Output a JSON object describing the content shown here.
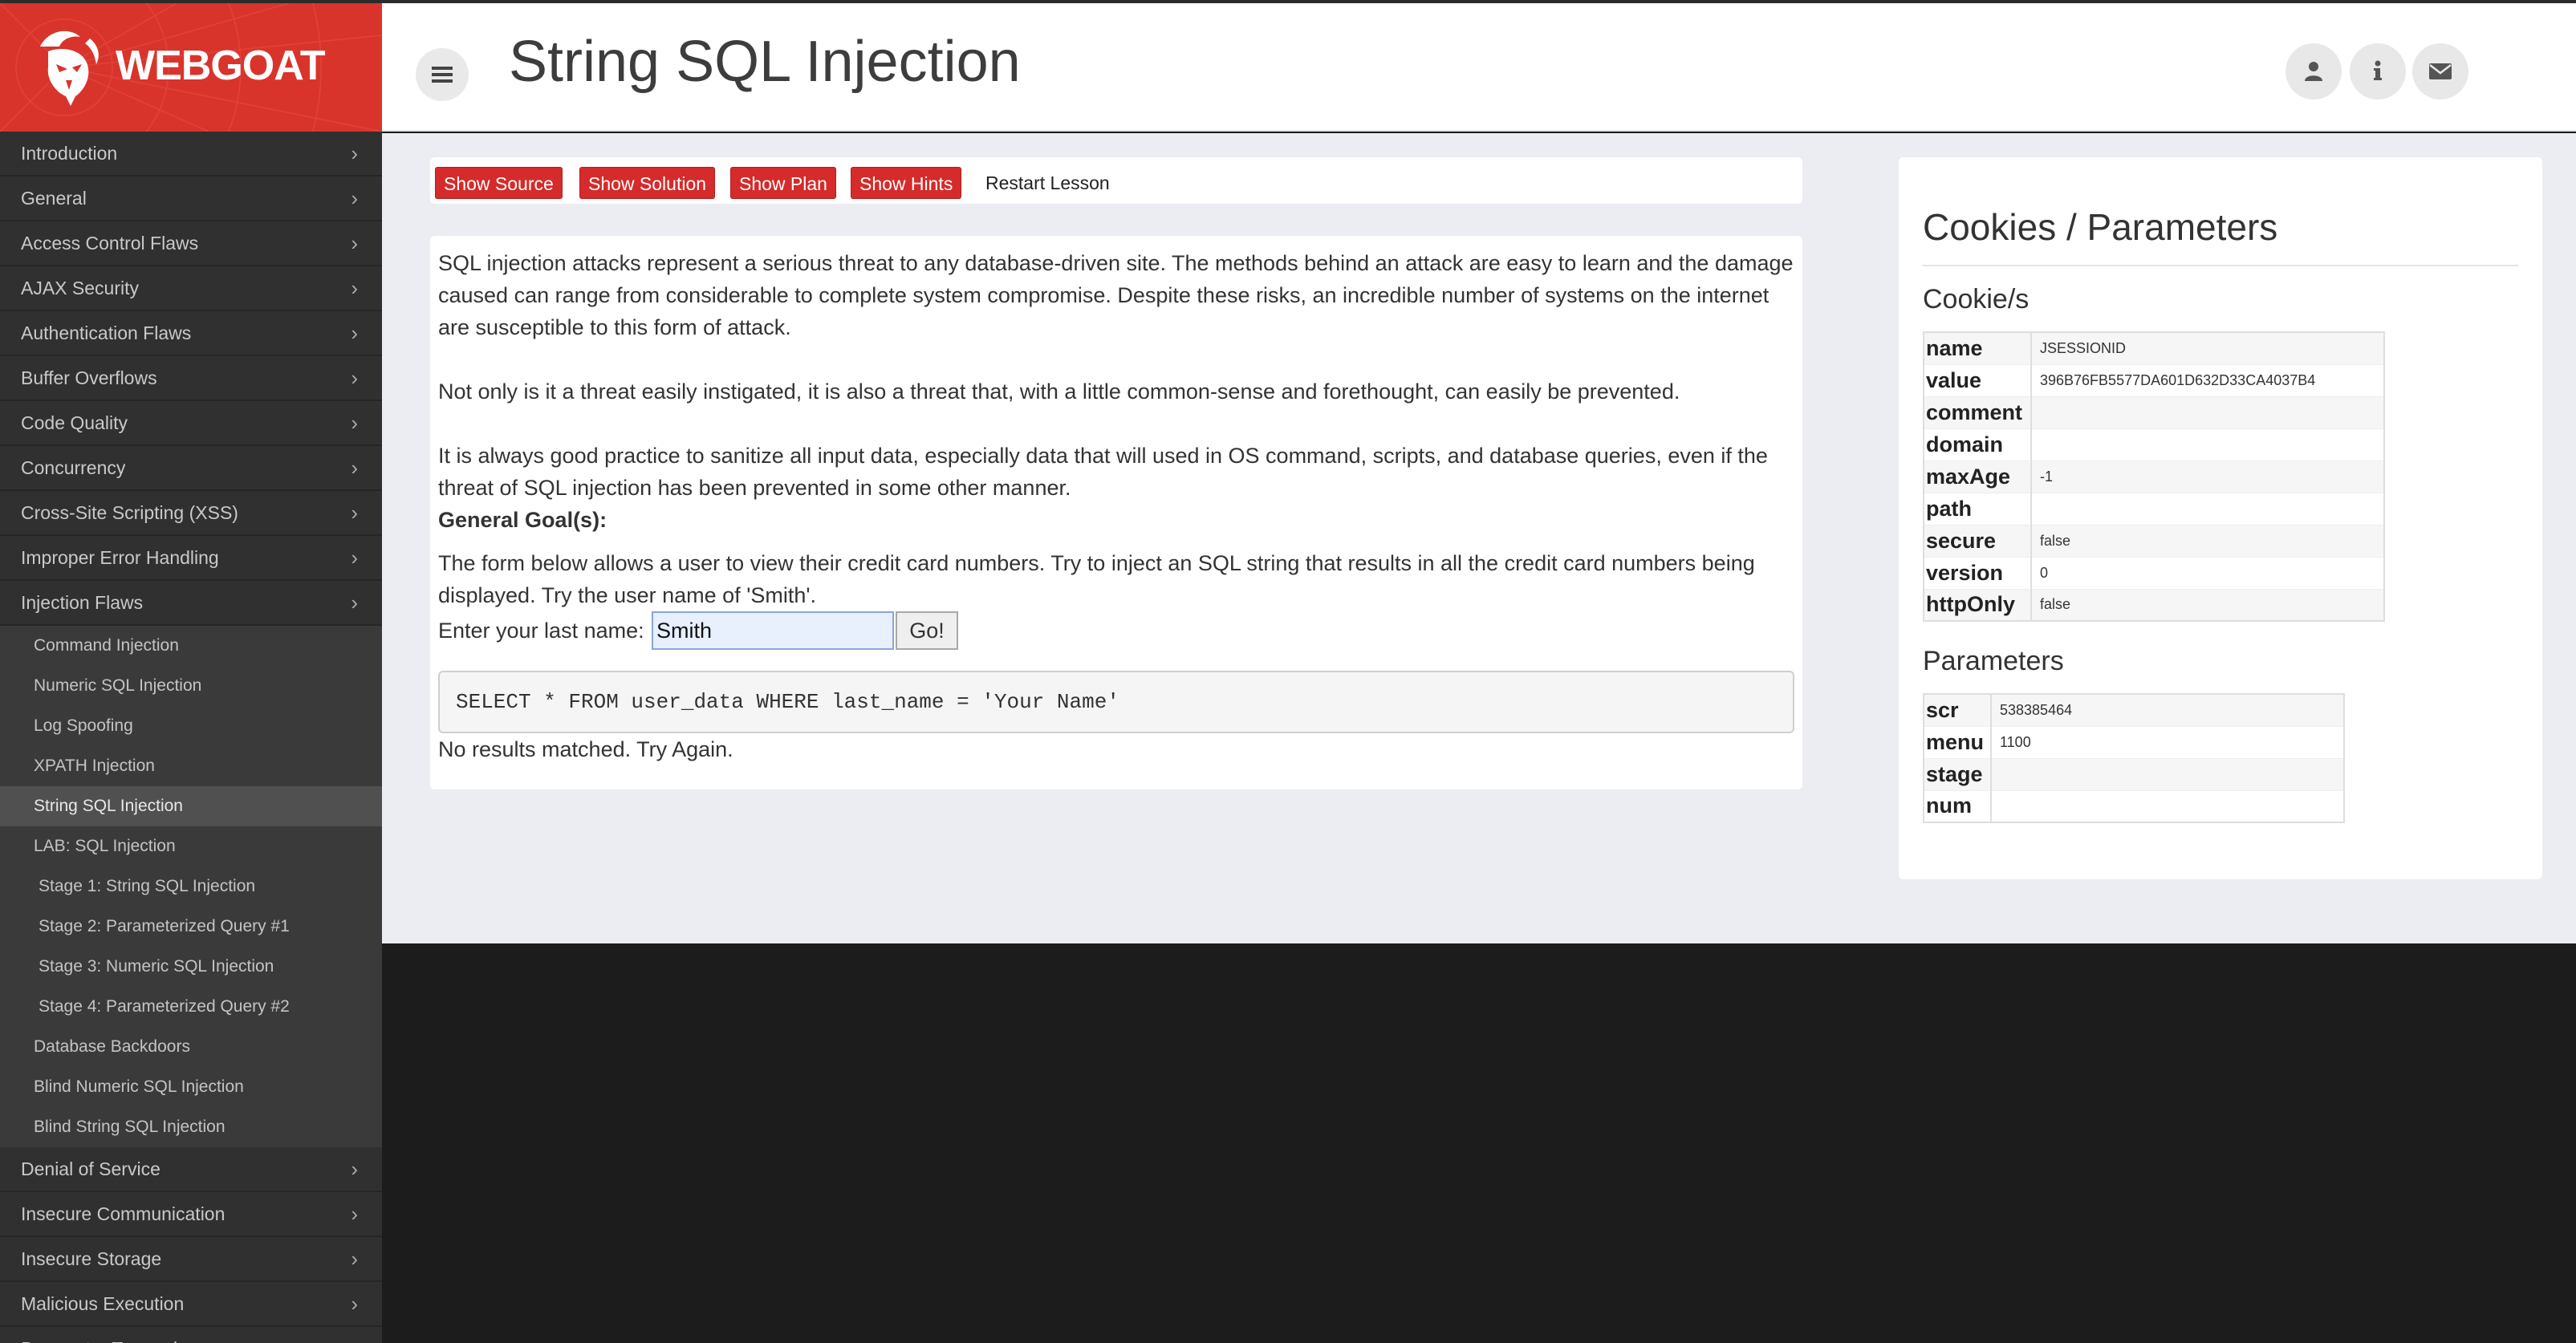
{
  "brand": {
    "name": "WEBGOAT"
  },
  "header": {
    "title": "String SQL Injection",
    "icons": [
      "bars-icon",
      "user-icon",
      "info-icon",
      "envelope-icon"
    ]
  },
  "sidebar": {
    "categories_top": [
      "Introduction",
      "General",
      "Access Control Flaws",
      "AJAX Security",
      "Authentication Flaws",
      "Buffer Overflows",
      "Code Quality",
      "Concurrency",
      "Cross-Site Scripting (XSS)",
      "Improper Error Handling",
      "Injection Flaws"
    ],
    "injection_lessons": [
      "Command Injection",
      "Numeric SQL Injection",
      "Log Spoofing",
      "XPATH Injection",
      "String SQL Injection",
      "LAB: SQL Injection",
      "Stage 1: String SQL Injection",
      "Stage 2: Parameterized Query #1",
      "Stage 3: Numeric SQL Injection",
      "Stage 4: Parameterized Query #2",
      "Database Backdoors",
      "Blind Numeric SQL Injection",
      "Blind String SQL Injection"
    ],
    "categories_bottom": [
      "Denial of Service",
      "Insecure Communication",
      "Insecure Storage",
      "Malicious Execution",
      "Parameter Tampering"
    ],
    "active_lesson": "String SQL Injection",
    "chevron": "›"
  },
  "toolbar": {
    "show_source": "Show Source",
    "show_solution": "Show Solution",
    "show_plan": "Show Plan",
    "show_hints": "Show Hints",
    "restart": "Restart Lesson"
  },
  "lesson": {
    "para1": "SQL injection attacks represent a serious threat to any database-driven site. The methods behind an attack are easy to learn and the damage caused can range from considerable to complete system compromise. Despite these risks, an incredible number of systems on the internet are susceptible to this form of attack.",
    "para2": "Not only is it a threat easily instigated, it is also a threat that, with a little common-sense and forethought, can easily be prevented.",
    "para3": "It is always good practice to sanitize all input data, especially data that will used in OS command, scripts, and database queries, even if the threat of SQL injection has been prevented in some other manner.",
    "goal_heading": "General Goal(s):",
    "goal_text": "The form below allows a user to view their credit card numbers. Try to inject an SQL string that results in all the credit card numbers being displayed. Try the user name of 'Smith'.",
    "form_label": "Enter your last name:",
    "input_value": "Smith",
    "go_label": "Go!",
    "query": "SELECT * FROM user_data WHERE last_name = 'Your Name'",
    "result": "No results matched. Try Again."
  },
  "cookies_panel": {
    "title": "Cookies / Parameters",
    "cookies_heading": "Cookie/s",
    "cookies": [
      {
        "key": "name",
        "value": "JSESSIONID"
      },
      {
        "key": "value",
        "value": "396B76FB5577DA601D632D33CA4037B4"
      },
      {
        "key": "comment",
        "value": ""
      },
      {
        "key": "domain",
        "value": ""
      },
      {
        "key": "maxAge",
        "value": "-1"
      },
      {
        "key": "path",
        "value": ""
      },
      {
        "key": "secure",
        "value": "false"
      },
      {
        "key": "version",
        "value": "0"
      },
      {
        "key": "httpOnly",
        "value": "false"
      }
    ],
    "params_heading": "Parameters",
    "params": [
      {
        "key": "scr",
        "value": "538385464"
      },
      {
        "key": "menu",
        "value": "1100"
      },
      {
        "key": "stage",
        "value": ""
      },
      {
        "key": "num",
        "value": ""
      }
    ]
  },
  "colors": {
    "brand_red": "#d9342c",
    "button_red": "#d52b2b",
    "sidebar_bg": "#2f2f2f",
    "content_bg": "#ececf3"
  }
}
